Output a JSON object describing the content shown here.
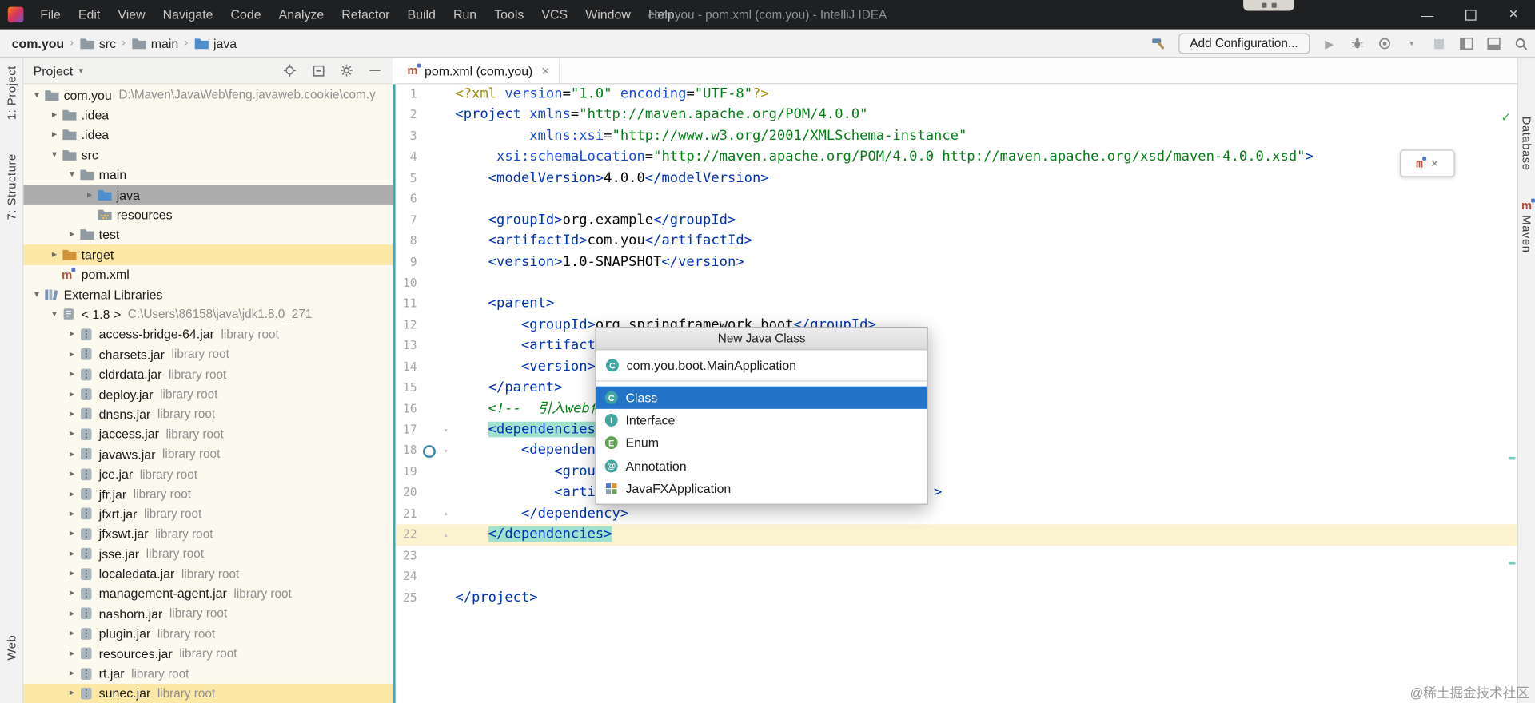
{
  "window": {
    "title": "com.you - pom.xml (com.you) - IntelliJ IDEA",
    "controls": [
      "minimize",
      "maximize",
      "close"
    ]
  },
  "menu": [
    "File",
    "Edit",
    "View",
    "Navigate",
    "Code",
    "Analyze",
    "Refactor",
    "Build",
    "Run",
    "Tools",
    "VCS",
    "Window",
    "Help"
  ],
  "navbar": {
    "breadcrumbs": [
      {
        "label": "com.you",
        "icon": ""
      },
      {
        "label": "src",
        "icon": "folder"
      },
      {
        "label": "main",
        "icon": "folder"
      },
      {
        "label": "java",
        "icon": "folder-java"
      }
    ],
    "add_configuration": "Add Configuration...",
    "right_icons": [
      "run-icon",
      "debug-icon",
      "coverage-icon",
      "chevron-down-icon",
      "stop-icon",
      "layout-left-icon",
      "layout-bottom-icon",
      "search-icon"
    ]
  },
  "left_stripe": [
    {
      "label": "1: Project"
    },
    {
      "label": "7: Structure"
    }
  ],
  "left_stripe_bottom": [
    {
      "label": "Web"
    }
  ],
  "right_stripe": [
    {
      "label": "Database",
      "icon": ""
    },
    {
      "label": "Maven",
      "icon": "maven"
    }
  ],
  "project_panel": {
    "header": {
      "title": "Project",
      "icons": [
        "locate-icon",
        "collapse-all-icon",
        "settings-icon",
        "minimize-icon"
      ]
    },
    "tree": [
      [
        0,
        "v",
        "folder-root",
        "com.you",
        "D:\\Maven\\JavaWeb\\feng.javaweb.cookie\\com.y",
        ""
      ],
      [
        1,
        ">",
        "folder",
        ".idea",
        "",
        ""
      ],
      [
        1,
        ">",
        "folder",
        ".idea",
        "",
        ""
      ],
      [
        1,
        "v",
        "folder",
        "src",
        "",
        ""
      ],
      [
        2,
        "v",
        "folder",
        "main",
        "",
        ""
      ],
      [
        3,
        ">",
        "folder-java",
        "java",
        "",
        "sel"
      ],
      [
        3,
        "",
        "folder-res",
        "resources",
        "",
        ""
      ],
      [
        2,
        ">",
        "folder",
        "test",
        "",
        ""
      ],
      [
        1,
        ">",
        "folder-target",
        "target",
        "",
        "yellow"
      ],
      [
        1,
        "",
        "maven",
        "pom.xml",
        "",
        ""
      ],
      [
        0,
        "v",
        "libs",
        "External Libraries",
        "",
        ""
      ],
      [
        1,
        "v",
        "jdk",
        "< 1.8 >",
        "C:\\Users\\86158\\java\\jdk1.8.0_271",
        ""
      ],
      [
        2,
        ">",
        "jar",
        "access-bridge-64.jar",
        "library root",
        ""
      ],
      [
        2,
        ">",
        "jar",
        "charsets.jar",
        "library root",
        ""
      ],
      [
        2,
        ">",
        "jar",
        "cldrdata.jar",
        "library root",
        ""
      ],
      [
        2,
        ">",
        "jar",
        "deploy.jar",
        "library root",
        ""
      ],
      [
        2,
        ">",
        "jar",
        "dnsns.jar",
        "library root",
        ""
      ],
      [
        2,
        ">",
        "jar",
        "jaccess.jar",
        "library root",
        ""
      ],
      [
        2,
        ">",
        "jar",
        "javaws.jar",
        "library root",
        ""
      ],
      [
        2,
        ">",
        "jar",
        "jce.jar",
        "library root",
        ""
      ],
      [
        2,
        ">",
        "jar",
        "jfr.jar",
        "library root",
        ""
      ],
      [
        2,
        ">",
        "jar",
        "jfxrt.jar",
        "library root",
        ""
      ],
      [
        2,
        ">",
        "jar",
        "jfxswt.jar",
        "library root",
        ""
      ],
      [
        2,
        ">",
        "jar",
        "jsse.jar",
        "library root",
        ""
      ],
      [
        2,
        ">",
        "jar",
        "localedata.jar",
        "library root",
        ""
      ],
      [
        2,
        ">",
        "jar",
        "management-agent.jar",
        "library root",
        ""
      ],
      [
        2,
        ">",
        "jar",
        "nashorn.jar",
        "library root",
        ""
      ],
      [
        2,
        ">",
        "jar",
        "plugin.jar",
        "library root",
        ""
      ],
      [
        2,
        ">",
        "jar",
        "resources.jar",
        "library root",
        ""
      ],
      [
        2,
        ">",
        "jar",
        "rt.jar",
        "library root",
        ""
      ],
      [
        2,
        ">",
        "jar",
        "sunec.jar",
        "library root",
        "yellow"
      ]
    ]
  },
  "editor": {
    "tab": {
      "label": "pom.xml (com.you)",
      "close": "×"
    },
    "caret_line": 22,
    "gutter_icon_line": 18,
    "inspection_ok": "✓",
    "lines": [
      {
        "n": 1,
        "p": [
          [
            "pi",
            "<?xml "
          ],
          [
            "attr",
            "version"
          ],
          [
            "pl",
            "="
          ],
          [
            "val",
            "\"1.0\""
          ],
          [
            "pl",
            " "
          ],
          [
            "attr",
            "encoding"
          ],
          [
            "pl",
            "="
          ],
          [
            "val",
            "\"UTF-8\""
          ],
          [
            "pi",
            "?>"
          ]
        ]
      },
      {
        "n": 2,
        "p": [
          [
            "tag",
            "<project"
          ],
          [
            "pl",
            " "
          ],
          [
            "attr",
            "xmlns"
          ],
          [
            "pl",
            "="
          ],
          [
            "val",
            "\"http://maven.apache.org/POM/4.0.0\""
          ]
        ]
      },
      {
        "n": 3,
        "p": [
          [
            "pl",
            "         "
          ],
          [
            "attr",
            "xmlns:xsi"
          ],
          [
            "pl",
            "="
          ],
          [
            "val",
            "\"http://www.w3.org/2001/XMLSchema-instance\""
          ]
        ]
      },
      {
        "n": 4,
        "p": [
          [
            "pl",
            "     "
          ],
          [
            "attr",
            "xsi:schemaLocation"
          ],
          [
            "pl",
            "="
          ],
          [
            "val",
            "\"http://maven.apache.org/POM/4.0.0 http://maven.apache.org/xsd/maven-4.0.0.xsd\""
          ],
          [
            "tag",
            ">"
          ]
        ]
      },
      {
        "n": 5,
        "p": [
          [
            "pl",
            "    "
          ],
          [
            "tag",
            "<modelVersion>"
          ],
          [
            "pl",
            "4.0.0"
          ],
          [
            "tag",
            "</modelVersion>"
          ]
        ]
      },
      {
        "n": 6,
        "p": []
      },
      {
        "n": 7,
        "p": [
          [
            "pl",
            "    "
          ],
          [
            "tag",
            "<groupId>"
          ],
          [
            "pl",
            "org.example"
          ],
          [
            "tag",
            "</groupId>"
          ]
        ]
      },
      {
        "n": 8,
        "p": [
          [
            "pl",
            "    "
          ],
          [
            "tag",
            "<artifactId>"
          ],
          [
            "pl",
            "com.you"
          ],
          [
            "tag",
            "</artifactId>"
          ]
        ]
      },
      {
        "n": 9,
        "p": [
          [
            "pl",
            "    "
          ],
          [
            "tag",
            "<version>"
          ],
          [
            "pl",
            "1.0-SNAPSHOT"
          ],
          [
            "tag",
            "</version>"
          ]
        ]
      },
      {
        "n": 10,
        "p": []
      },
      {
        "n": 11,
        "p": [
          [
            "pl",
            "    "
          ],
          [
            "tag",
            "<parent>"
          ]
        ]
      },
      {
        "n": 12,
        "p": [
          [
            "pl",
            "        "
          ],
          [
            "tag",
            "<groupId>"
          ],
          [
            "pl",
            "org.springframework.boot"
          ],
          [
            "tag",
            "</groupId>"
          ]
        ]
      },
      {
        "n": 13,
        "p": [
          [
            "pl",
            "        "
          ],
          [
            "tag",
            "<artifactId>"
          ]
        ]
      },
      {
        "n": 14,
        "p": [
          [
            "pl",
            "        "
          ],
          [
            "tag",
            "<version>"
          ]
        ]
      },
      {
        "n": 15,
        "p": [
          [
            "pl",
            "    "
          ],
          [
            "tag",
            "</parent>"
          ]
        ]
      },
      {
        "n": 16,
        "p": [
          [
            "pl",
            "    "
          ],
          [
            "com",
            "<!--  引入web依赖-->"
          ]
        ]
      },
      {
        "n": 17,
        "p": [
          [
            "pl",
            "    "
          ],
          [
            "taghl",
            "<dependencies>"
          ]
        ],
        "fold": "v"
      },
      {
        "n": 18,
        "p": [
          [
            "pl",
            "        "
          ],
          [
            "tag",
            "<dependency>"
          ]
        ],
        "fold": "v"
      },
      {
        "n": 19,
        "p": [
          [
            "pl",
            "            "
          ],
          [
            "tag",
            "<groupId>"
          ]
        ]
      },
      {
        "n": 20,
        "p": [
          [
            "pl",
            "            "
          ],
          [
            "tag",
            "<arti"
          ],
          [
            "pl",
            "                                         "
          ],
          [
            "tag",
            ">"
          ]
        ]
      },
      {
        "n": 21,
        "p": [
          [
            "pl",
            "        "
          ],
          [
            "tag",
            "</dependency>"
          ]
        ],
        "fold": "^"
      },
      {
        "n": 22,
        "p": [
          [
            "pl",
            "    "
          ],
          [
            "taghl",
            "</dependencies>"
          ]
        ],
        "fold": "^"
      },
      {
        "n": 23,
        "p": []
      },
      {
        "n": 24,
        "p": []
      },
      {
        "n": 25,
        "p": [
          [
            "tag",
            "</project>"
          ]
        ]
      }
    ]
  },
  "popup": {
    "title": "New Java Class",
    "input": {
      "icon": "class",
      "value": "com.you.boot.MainApplication"
    },
    "items": [
      {
        "icon": "class",
        "label": "Class",
        "selected": true
      },
      {
        "icon": "interface",
        "label": "Interface"
      },
      {
        "icon": "enum",
        "label": "Enum"
      },
      {
        "icon": "annotation",
        "label": "Annotation"
      },
      {
        "icon": "javafx",
        "label": "JavaFXApplication"
      }
    ]
  },
  "watermark": "@稀土掘金技术社区",
  "colors": {
    "selection_gray": "#acacac",
    "row_yellow": "#fbe7a6",
    "tag_highlight": "#a0e1cf",
    "caret_row": "#fbf2cf",
    "popup_selected": "#2373c8",
    "titlebar_bg": "#1f2022"
  }
}
